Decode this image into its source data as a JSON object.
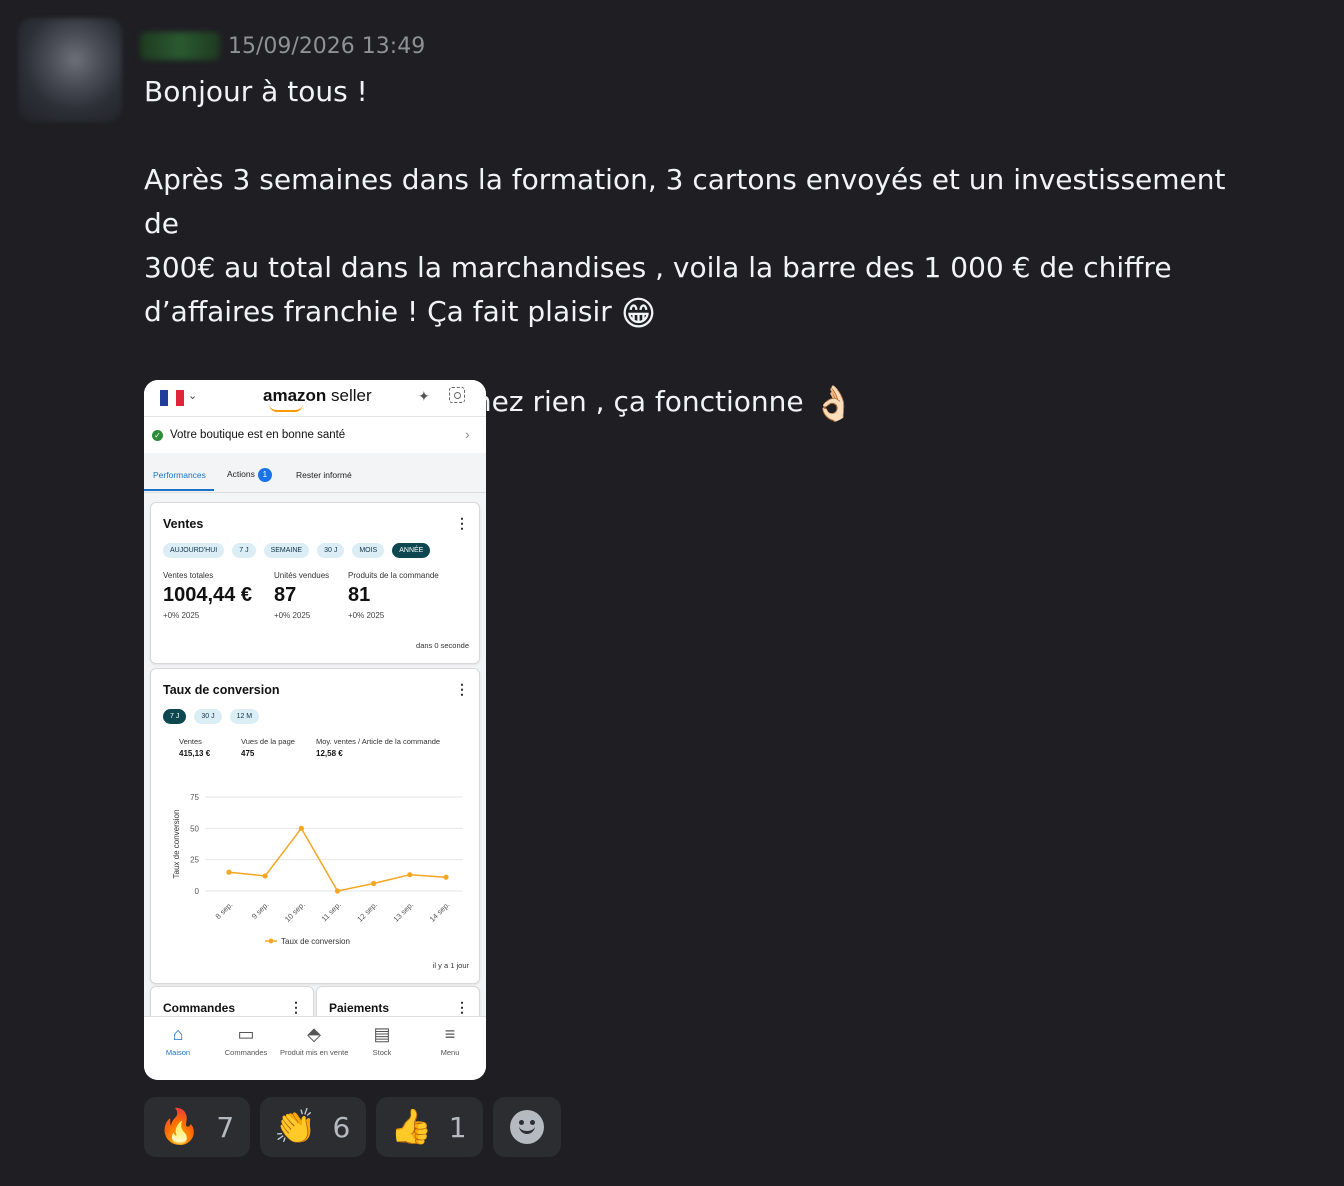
{
  "message": {
    "timestamp": "15/09/2026 13:49",
    "lines": {
      "l1": "Bonjour à tous !",
      "l2": "Après 3 semaines dans la formation, 3 cartons envoyés et un investissement de",
      "l3": "300€ au total dans la marchandises , voila la barre des 1 000 € de chiffre",
      "l4": "d’affaires franchie ! Ça fait plaisir",
      "l4_emoji": "😁",
      "l5": "Courage à tous ! Ne lâchez rien , ça fonctionne",
      "l5_emoji": "👌🏻"
    }
  },
  "app": {
    "brand_bold": "amazon",
    "brand_light": " seller",
    "health": "Votre boutique est en bonne santé",
    "tabs": {
      "performances": "Performances",
      "actions": "Actions",
      "actions_badge": "1",
      "rester": "Rester informé"
    },
    "ventes": {
      "title": "Ventes",
      "chips": [
        "AUJOURD'HUI",
        "7 J",
        "SEMAINE",
        "30 J",
        "MOIS",
        "ANNÉE"
      ],
      "selected_chip": "ANNÉE",
      "stats": [
        {
          "label": "Ventes totales",
          "value": "1004,44 €",
          "delta": "+0% 2025"
        },
        {
          "label": "Unités vendues",
          "value": "87",
          "delta": "+0% 2025"
        },
        {
          "label": "Produits de la commande",
          "value": "81",
          "delta": "+0% 2025"
        }
      ],
      "footnote": "dans 0 seconde"
    },
    "conversion": {
      "title": "Taux de conversion",
      "chips": [
        "7 J",
        "30 J",
        "12 M"
      ],
      "selected_chip": "7 J",
      "stats": [
        {
          "label": "Ventes",
          "value": "415,13 €"
        },
        {
          "label": "Vues de la page",
          "value": "475"
        },
        {
          "label": "Moy. ventes / Article de la commande",
          "value": "12,58 €"
        }
      ],
      "footnote": "il y a 1 jour"
    },
    "bottom_cards": {
      "commandes": "Commandes",
      "paiements": "Paiements"
    },
    "bottom_nav": [
      {
        "label": "Maison",
        "icon": "home-icon",
        "active": true
      },
      {
        "label": "Commandes",
        "icon": "box-icon",
        "active": false
      },
      {
        "label": "Produit mis en vente",
        "icon": "tag-icon",
        "active": false
      },
      {
        "label": "Stock",
        "icon": "clipboard-icon",
        "active": false
      },
      {
        "label": "Menu",
        "icon": "menu-icon",
        "active": false
      }
    ],
    "flag_colors": [
      "#1f3f9a",
      "#ffffff",
      "#e0243a"
    ],
    "accent": "#1a73c8"
  },
  "chart_data": {
    "type": "line",
    "ylabel": "Taux de conversion",
    "ylim": [
      0,
      75
    ],
    "yticks": [
      0,
      25,
      50,
      75
    ],
    "categories": [
      "8 sep.",
      "9 sep.",
      "10 sep.",
      "11 sep.",
      "12 sep.",
      "13 sep.",
      "14 sep."
    ],
    "series": [
      {
        "name": "Taux de conversion",
        "values": [
          15,
          12,
          50,
          0,
          6,
          13,
          11
        ],
        "color": "#f5a623"
      }
    ],
    "grid": true,
    "legend": "bottom"
  },
  "reactions": [
    {
      "emoji": "🔥",
      "count": "7"
    },
    {
      "emoji": "👏",
      "count": "6"
    },
    {
      "emoji": "👍",
      "count": "1"
    }
  ]
}
